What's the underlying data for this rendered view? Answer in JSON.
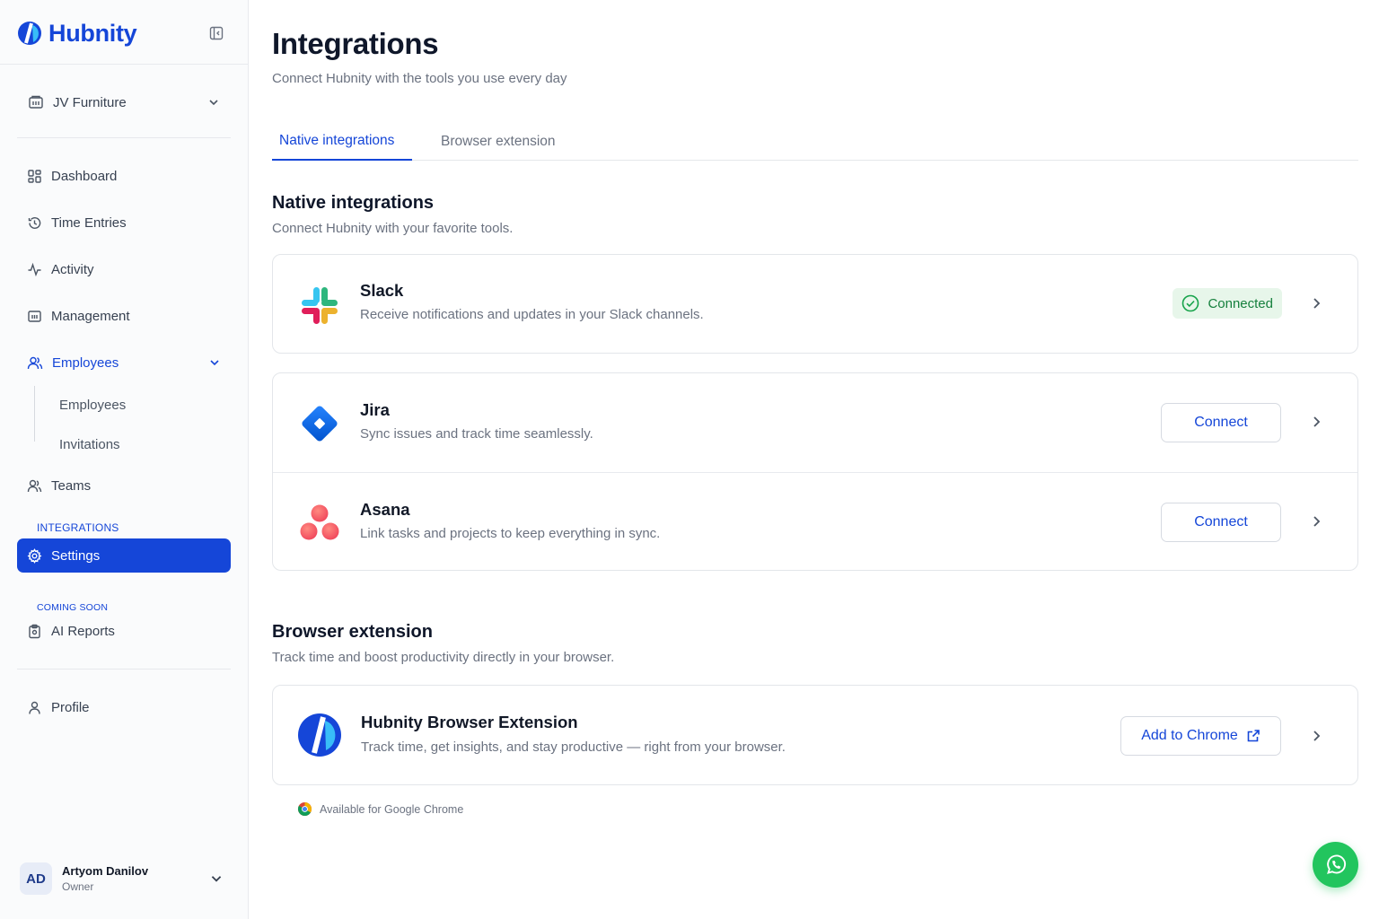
{
  "brand": {
    "name": "Hubnity"
  },
  "sidebar": {
    "workspace": {
      "label": "JV Furniture"
    },
    "nav": {
      "dashboard": "Dashboard",
      "time_entries": "Time Entries",
      "activity": "Activity",
      "management": "Management",
      "employees": "Employees",
      "employees_sub": "Employees",
      "invitations": "Invitations",
      "teams": "Teams",
      "settings": "Settings",
      "ai_reports": "AI Reports",
      "profile": "Profile"
    },
    "sections": {
      "integrations": "INTEGRATIONS",
      "coming_soon": "COMING SOON"
    },
    "user": {
      "initials": "AD",
      "name": "Artyom Danilov",
      "role": "Owner"
    }
  },
  "page": {
    "title": "Integrations",
    "subtitle": "Connect Hubnity with the tools you use every day"
  },
  "tabs": [
    {
      "label": "Native integrations",
      "active": true
    },
    {
      "label": "Browser extension",
      "active": false
    }
  ],
  "native": {
    "title": "Native integrations",
    "subtitle": "Connect Hubnity with your favorite tools.",
    "items": [
      {
        "name": "Slack",
        "description": "Receive notifications and updates in your Slack channels.",
        "status": "Connected",
        "icon": "slack-logo"
      },
      {
        "name": "Jira",
        "description": "Sync issues and track time seamlessly.",
        "action": "Connect",
        "icon": "jira-logo"
      },
      {
        "name": "Asana",
        "description": "Link tasks and projects to keep everything in sync.",
        "action": "Connect",
        "icon": "asana-logo"
      }
    ]
  },
  "browser": {
    "title": "Browser extension",
    "subtitle": "Track time and boost productivity directly in your browser.",
    "extension": {
      "name": "Hubnity Browser Extension",
      "description": "Track time, get insights, and stay productive — right from your browser.",
      "action": "Add to Chrome"
    },
    "availability": "Available for Google Chrome"
  },
  "colors": {
    "accent": "#1546d8",
    "connected_bg": "#e7f6ea",
    "connected_text": "#15803d",
    "whatsapp": "#22c55e"
  }
}
